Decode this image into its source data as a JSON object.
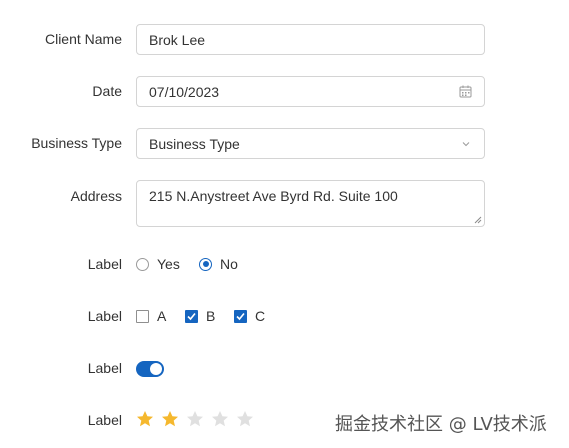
{
  "form": {
    "client_name": {
      "label": "Client Name",
      "value": "Brok Lee"
    },
    "date": {
      "label": "Date",
      "value": "07/10/2023",
      "icon": "calendar-icon"
    },
    "business_type": {
      "label": "Business Type",
      "value": "Business Type",
      "icon": "chevron-down-icon"
    },
    "address": {
      "label": "Address",
      "value": "215 N.Anystreet Ave Byrd Rd. Suite 100"
    },
    "radio_field": {
      "label": "Label",
      "options": [
        {
          "text": "Yes",
          "checked": false
        },
        {
          "text": "No",
          "checked": true
        }
      ]
    },
    "checkbox_field": {
      "label": "Label",
      "options": [
        {
          "text": "A",
          "checked": false
        },
        {
          "text": "B",
          "checked": true
        },
        {
          "text": "C",
          "checked": true
        }
      ]
    },
    "toggle_field": {
      "label": "Label",
      "on": true
    },
    "rating_field": {
      "label": "Label",
      "value": 2,
      "max": 5
    }
  },
  "colors": {
    "accent": "#1565c0",
    "star_filled": "#f5b82e",
    "star_empty": "#e0e0e0",
    "border": "#d4d4d4",
    "text": "#333333"
  },
  "watermark": "掘金技术社区 @ LV技术派"
}
